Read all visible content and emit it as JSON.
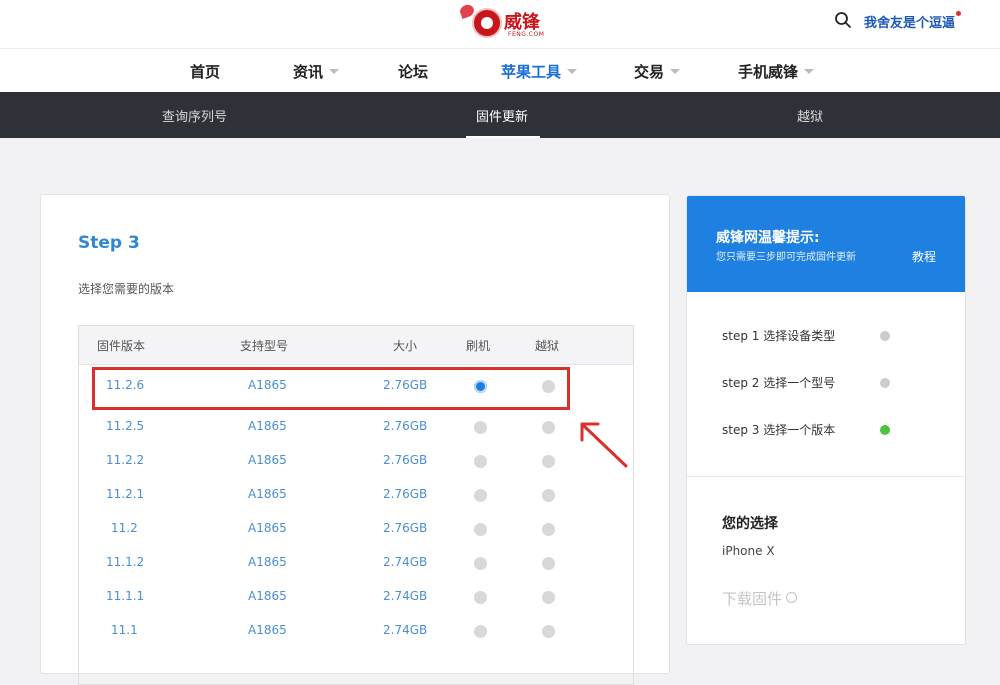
{
  "header": {
    "brand": "威锋",
    "brand_sub": "FENG.COM",
    "user_link": "我舍友是个逗逼"
  },
  "main_nav": {
    "items": [
      {
        "label": "首页",
        "dropdown": false
      },
      {
        "label": "资讯",
        "dropdown": true
      },
      {
        "label": "论坛",
        "dropdown": false
      },
      {
        "label": "苹果工具",
        "dropdown": true,
        "active": true
      },
      {
        "label": "交易",
        "dropdown": true
      },
      {
        "label": "手机威锋",
        "dropdown": true
      }
    ]
  },
  "sub_nav": {
    "items": [
      {
        "label": "查询序列号"
      },
      {
        "label": "固件更新",
        "active": true
      },
      {
        "label": "越狱"
      }
    ]
  },
  "step": {
    "title": "Step 3",
    "description": "选择您需要的版本"
  },
  "table": {
    "headers": [
      "固件版本",
      "支持型号",
      "大小",
      "刷机",
      "越狱"
    ],
    "rows": [
      {
        "version": "11.2.6",
        "model": "A1865",
        "size": "2.76GB",
        "flash_selected": true
      },
      {
        "version": "11.2.5",
        "model": "A1865",
        "size": "2.76GB",
        "flash_selected": false
      },
      {
        "version": "11.2.2",
        "model": "A1865",
        "size": "2.76GB",
        "flash_selected": false
      },
      {
        "version": "11.2.1",
        "model": "A1865",
        "size": "2.76GB",
        "flash_selected": false
      },
      {
        "version": "11.2",
        "model": "A1865",
        "size": "2.76GB",
        "flash_selected": false
      },
      {
        "version": "11.1.2",
        "model": "A1865",
        "size": "2.74GB",
        "flash_selected": false
      },
      {
        "version": "11.1.1",
        "model": "A1865",
        "size": "2.74GB",
        "flash_selected": false
      },
      {
        "version": "11.1",
        "model": "A1865",
        "size": "2.74GB",
        "flash_selected": false
      }
    ]
  },
  "side_panel": {
    "tip_title": "威锋网温馨提示:",
    "tip_sub": "您只需要三步即可完成固件更新",
    "tutorial": "教程",
    "steps": [
      {
        "label": "step 1  选择设备类型",
        "done": false
      },
      {
        "label": "step 2  选择一个型号",
        "done": false
      },
      {
        "label": "step 3  选择一个版本",
        "done": true
      }
    ],
    "choice_title": "您的选择",
    "choice_value": "iPhone X",
    "download": "下载固件"
  },
  "colors": {
    "accent": "#1e80e0",
    "highlight": "#d9302c",
    "selected_radio": "#1a7fe0",
    "done_dot": "#4cc23e"
  }
}
